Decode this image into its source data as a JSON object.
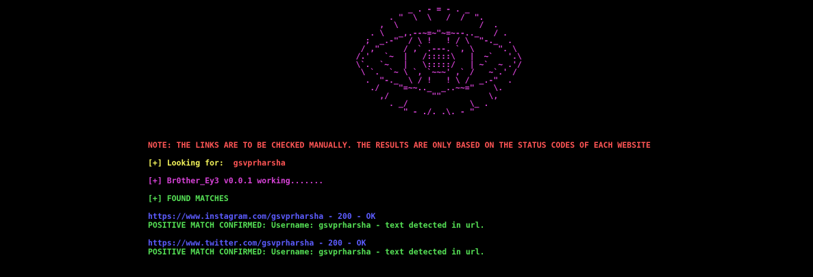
{
  "banner": {
    "ascii_art": "                 _ . - = - . _\n             . \"  \\  \\   /  /  \".\n           ,  \\                 /  .\n         . \\   _,.--~=~\"~=~--.._   / .\n        ;  _.-\"  / \\ !   ! / \\  \"-._  .\n       / ,\"     / ,` .---. `, \\     \". \\\n      /.'   `~  |   /:::::\\   |  ~`   '.\\\n      \\`.  `~   |   \\:::::/   | ~`  ~ .'/\n       \\ `.  `~ \\ `, `~~~' ,` /   ~`.' /\n        .  \"-._  \\ / !   ! \\ /  _.-\"  .\n         ./    \"=~~.._  _..~~=\"    \\.\n           ,/         \"\"          \\,\n             . _/             \\_ .\n                \" - ./. .\\. - \"",
    "color": "#d642d6"
  },
  "output": {
    "note": "NOTE: THE LINKS ARE TO BE CHECKED MANUALLY. THE RESULTS ARE ONLY BASED ON THE STATUS CODES OF EACH WEBSITE",
    "looking_prefix": "[+] Looking for: ",
    "username": "gsvprharsha",
    "working": "[+] Br0ther_Ey3 v0.0.1 working.......",
    "found": "[+] FOUND MATCHES",
    "results": [
      {
        "url_line": "https://www.instagram.com/gsvprharsha - 200 - OK",
        "confirm_line": "POSITIVE MATCH CONFIRMED: Username: gsvprharsha - text detected in url."
      },
      {
        "url_line": "https://www.twitter.com/gsvprharsha - 200 - OK",
        "confirm_line": "POSITIVE MATCH CONFIRMED: Username: gsvprharsha - text detected in url."
      }
    ]
  },
  "colors": {
    "background": "#000000",
    "magenta": "#d642d6",
    "red": "#ff5555",
    "yellow": "#f2f25a",
    "green": "#55e055",
    "blue": "#5c5cff"
  }
}
